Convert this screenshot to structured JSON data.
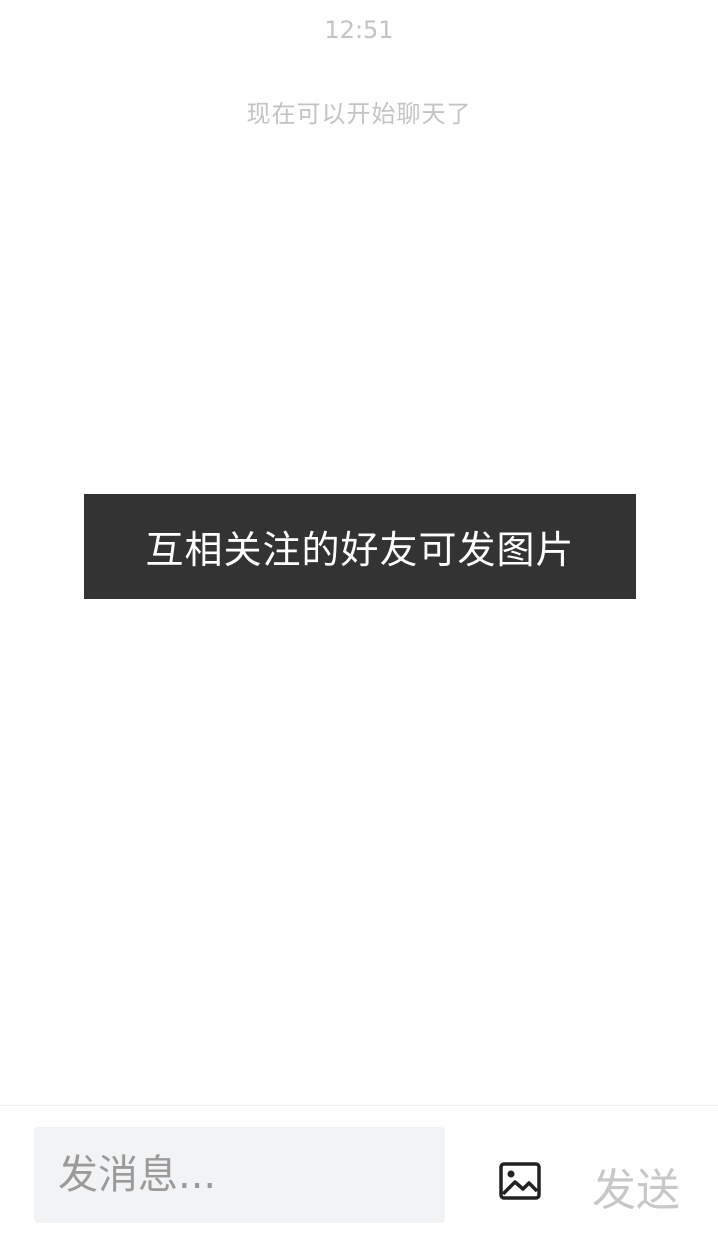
{
  "chat": {
    "timestamp": "12:51",
    "system_note": "现在可以开始聊天了"
  },
  "toast": {
    "message": "互相关注的好友可发图片"
  },
  "composer": {
    "placeholder": "发消息...",
    "value": "",
    "image_icon": "image-icon",
    "send_label": "发送"
  },
  "colors": {
    "toast_background": "#333333",
    "muted_text": "#c4c4c4",
    "input_background": "#f2f3f5",
    "send_disabled": "#c8c8c8"
  }
}
